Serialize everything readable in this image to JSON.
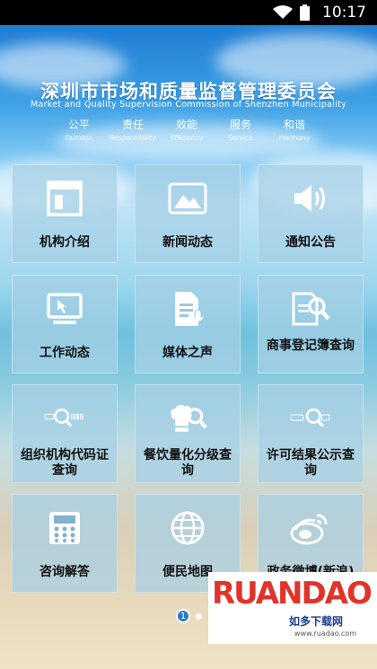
{
  "status_bar": {
    "time": "10:17"
  },
  "header": {
    "title_cn": "深圳市市场和质量监督管理委员会",
    "title_en": "Market and Quality Supervision  Commission of Shenzhen Municipality",
    "values": [
      {
        "cn": "公平",
        "en": "Fairness"
      },
      {
        "cn": "责任",
        "en": "Responsibility"
      },
      {
        "cn": "效能",
        "en": "Efficiency"
      },
      {
        "cn": "服务",
        "en": "Service"
      },
      {
        "cn": "和谐",
        "en": "Harmony"
      }
    ]
  },
  "tiles": [
    {
      "label": "机构介绍",
      "icon": "layout-icon"
    },
    {
      "label": "新闻动态",
      "icon": "image-icon"
    },
    {
      "label": "通知公告",
      "icon": "speaker-icon"
    },
    {
      "label": "工作动态",
      "icon": "monitor-icon"
    },
    {
      "label": "媒体之声",
      "icon": "document-mic-icon"
    },
    {
      "label": "商事登记簿查询",
      "icon": "document-search-icon"
    },
    {
      "label": "组织机构代码证查询",
      "icon": "code-search-icon"
    },
    {
      "label": "餐饮量化分级查询",
      "icon": "chef-search-icon"
    },
    {
      "label": "许可结果公示查询",
      "icon": "license-search-icon"
    },
    {
      "label": "咨询解答",
      "icon": "phone-icon"
    },
    {
      "label": "便民地图",
      "icon": "globe-icon"
    },
    {
      "label": "政务微博(新浪)",
      "icon": "weibo-icon"
    }
  ],
  "pager": {
    "current": "1"
  },
  "watermark": {
    "brand": "RUANDAO",
    "sub": "如多下载网",
    "url": "www.ruadao.com"
  }
}
